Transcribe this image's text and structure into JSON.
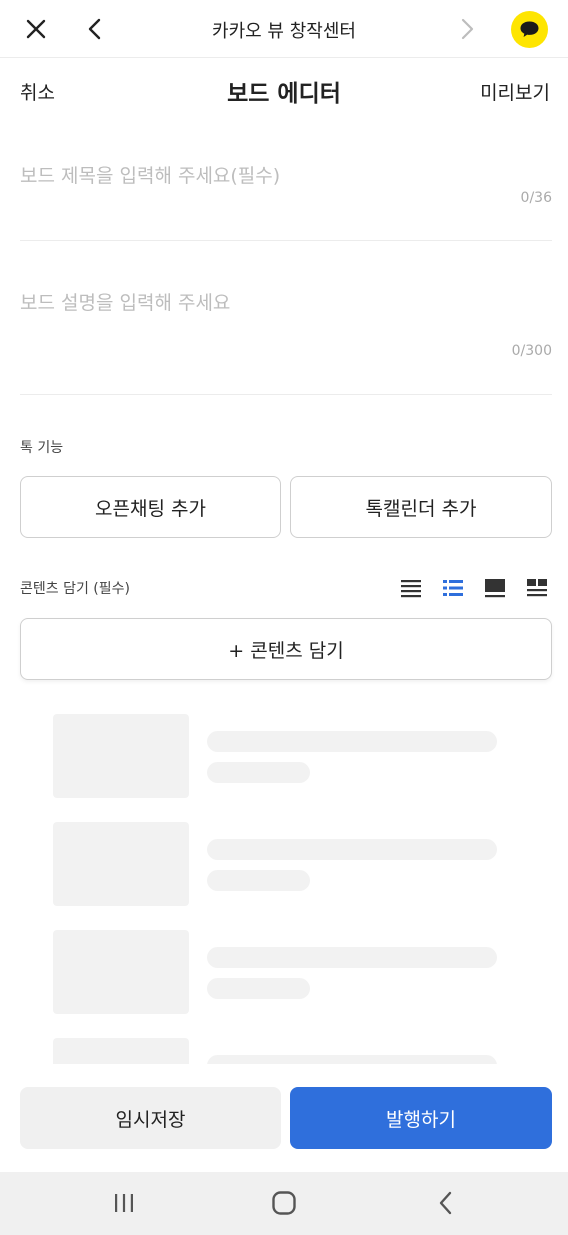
{
  "topbar": {
    "title": "카카오 뷰 창작센터",
    "icons": [
      "close-icon",
      "back-chevron-icon",
      "forward-chevron-icon",
      "kakaotalk-icon"
    ],
    "kakao_color": "#FEE500"
  },
  "editor": {
    "cancel_label": "취소",
    "title": "보드 에디터",
    "preview_label": "미리보기"
  },
  "board_title_field": {
    "placeholder": "보드 제목을 입력해 주세요(필수)",
    "counter": "0/36"
  },
  "board_desc_field": {
    "placeholder": "보드 설명을 입력해 주세요",
    "counter": "0/300"
  },
  "talk_features": {
    "label": "톡 기능",
    "open_chat_label": "오픈채팅 추가",
    "talk_calendar_label": "톡캘린더 추가"
  },
  "contents": {
    "label": "콘텐츠 담기 (필수)",
    "view_modes": [
      "list-compact-icon",
      "list-thumbnail-icon",
      "card-large-icon",
      "grid-icon"
    ],
    "selected_view_mode": "list-thumbnail-icon",
    "add_label": "+ 콘텐츠 담기"
  },
  "footer": {
    "draft_label": "임시저장",
    "publish_label": "발행하기",
    "publish_color": "#2F6FDC"
  },
  "system_nav": {
    "icons": [
      "recent-apps-icon",
      "home-icon",
      "back-icon"
    ]
  }
}
